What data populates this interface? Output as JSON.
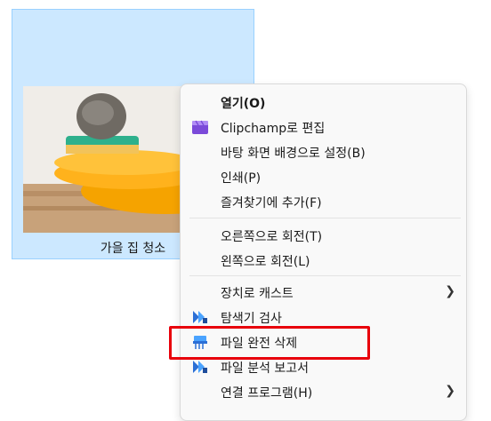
{
  "file": {
    "name": "가을 집 청소"
  },
  "menu": {
    "items": [
      {
        "label": "열기(O)",
        "icon": "none",
        "bold": true
      },
      {
        "label": "Clipchamp로 편집",
        "icon": "clipchamp-icon"
      },
      {
        "label": "바탕 화면 배경으로 설정(B)",
        "icon": "none"
      },
      {
        "label": "인쇄(P)",
        "icon": "none"
      },
      {
        "label": "즐겨찾기에 추가(F)",
        "icon": "none"
      },
      {
        "label": "오른쪽으로 회전(T)",
        "icon": "none"
      },
      {
        "label": "왼쪽으로 회전(L)",
        "icon": "none"
      },
      {
        "label": "장치로 캐스트",
        "icon": "none",
        "submenu": true
      },
      {
        "label": "탐색기 검사",
        "icon": "scanner-icon"
      },
      {
        "label": "파일 완전 삭제",
        "icon": "shredder-icon"
      },
      {
        "label": "파일 분석 보고서",
        "icon": "scanner-icon"
      },
      {
        "label": "연결 프로그램(H)",
        "icon": "none",
        "submenu": true
      }
    ]
  },
  "colors": {
    "selection": "#cce8ff",
    "highlight_box": "#e8000b"
  }
}
